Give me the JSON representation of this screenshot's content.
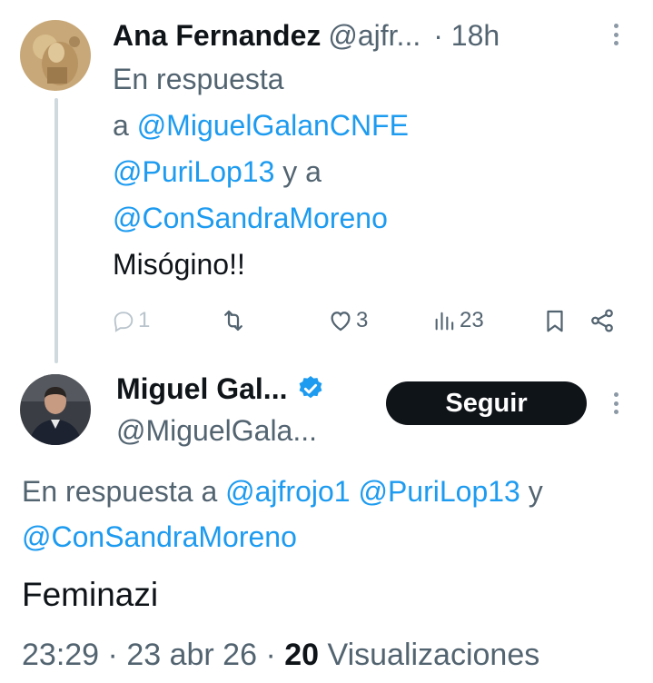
{
  "reply_tweet": {
    "author_name": "Ana Fernandez",
    "handle": "@ajfr...",
    "time": "· 18h",
    "reply_prefix": "En respuesta",
    "reply_a": "a",
    "mention_1": "@MiguelGalanCNFE",
    "mention_2": "@PuriLop13",
    "reply_and": "y a",
    "mention_3": "@ConSandraMoreno",
    "text": "Misógino!!",
    "actions": {
      "reply_count": "1",
      "like_count": "3",
      "views_count": "23"
    }
  },
  "main_tweet": {
    "author_name": "Miguel Gal...",
    "handle": "@MiguelGala...",
    "follow_label": "Seguir",
    "reply_prefix": "En respuesta a",
    "mention_1": "@ajfrojo1",
    "mention_2": "@PuriLop13",
    "reply_and": "y",
    "mention_3": "@ConSandraMoreno",
    "text": "Feminazi",
    "time": "23:29",
    "date": "23 abr 26",
    "views_number": "20",
    "views_label": "Visualizaciones"
  },
  "colors": {
    "link": "#1d9bf0",
    "secondary_text": "#536471",
    "primary_text": "#0f1419",
    "verified": "#1d9bf0"
  },
  "icons": [
    "reply-icon",
    "retweet-icon",
    "like-icon",
    "views-icon",
    "bookmark-icon",
    "share-icon",
    "verified-badge-icon",
    "more-icon"
  ]
}
